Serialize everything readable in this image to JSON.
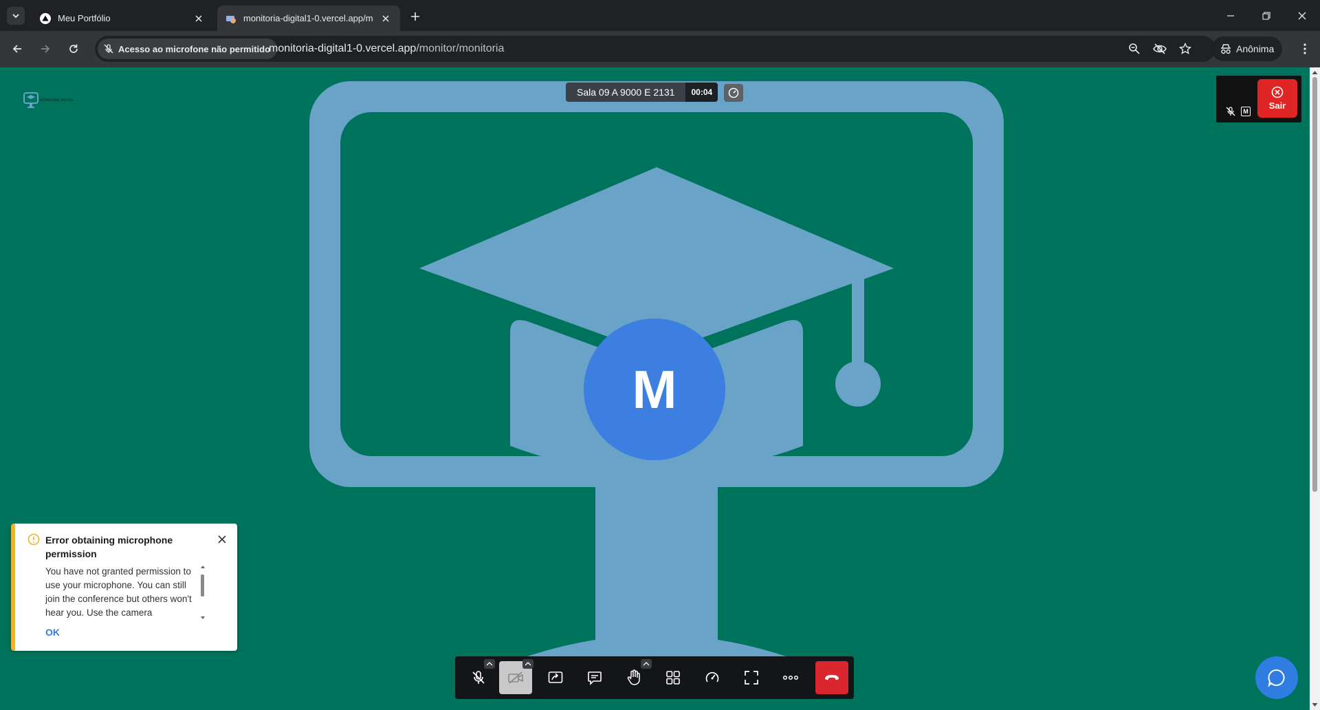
{
  "browser": {
    "tabs": [
      {
        "title": "Meu Portfólio",
        "active": false
      },
      {
        "title": "monitoria-digital1-0.vercel.app/m",
        "active": true
      }
    ],
    "permission_chip": "Acesso ao microfone não permitido",
    "url_host": "monitoria-digital1-0.vercel.app",
    "url_path": "/monitor/monitoria",
    "profile_label": "Anônima"
  },
  "meeting": {
    "room_name": "Sala 09 A 9000 E 2131",
    "elapsed_time": "00:04",
    "avatar_initial": "M",
    "thumbnail_initial": "M",
    "exit_label": "Sair",
    "logo_text": "MONITORIA DIGITAL",
    "background_color": "#00735c",
    "avatar_color": "#3d7fe0"
  },
  "notification": {
    "title": "Error obtaining microphone permission",
    "body": "You have not granted permission to use your microphone. You can still join the conference but others won't hear you. Use the camera",
    "ok_label": "OK",
    "accent_color": "#f0b429"
  },
  "toolbar_icons": [
    "mic-muted-icon",
    "camera-off-icon",
    "screen-share-icon",
    "chat-icon",
    "raise-hand-icon",
    "tile-view-icon",
    "performance-icon",
    "fullscreen-icon",
    "more-icon",
    "hangup-icon"
  ]
}
